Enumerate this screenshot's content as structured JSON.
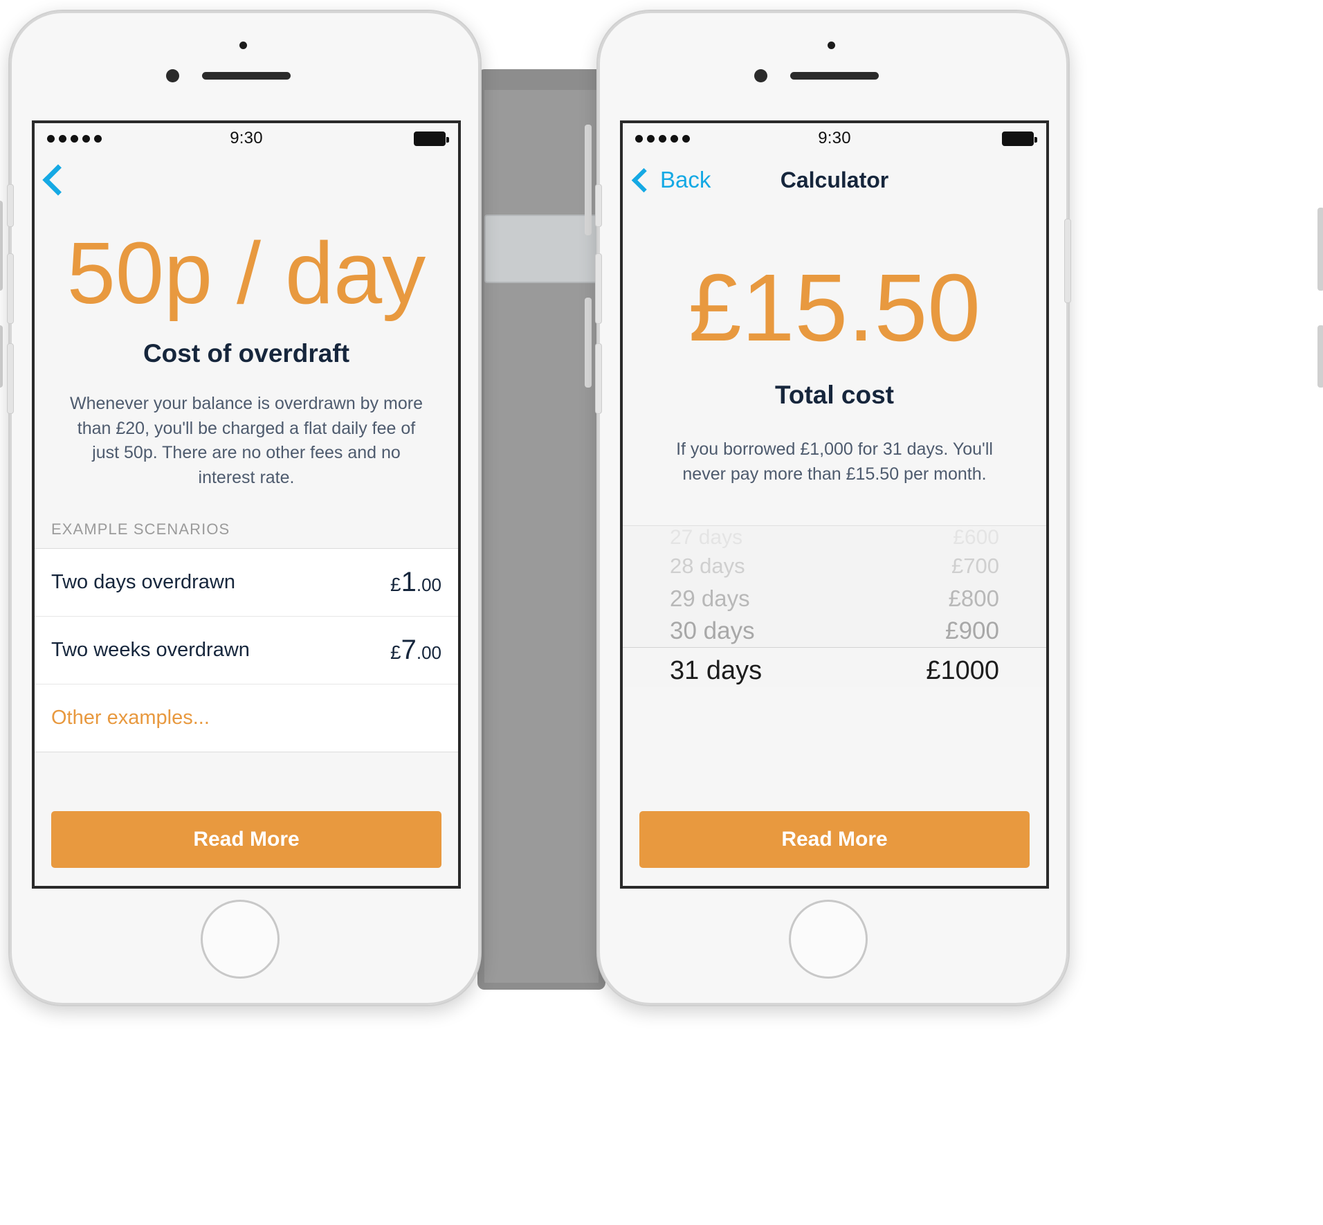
{
  "screens": [
    {
      "id": "cost-of-overdraft",
      "status": {
        "time": "9:30",
        "signal_dots": 5,
        "battery": "full"
      },
      "nav": {
        "back_label": "",
        "title": ""
      },
      "hero": {
        "amount": "50p / day",
        "label": "Cost of overdraft",
        "description": "Whenever your balance is overdrawn by more than £20, you'll be charged a flat daily fee of just 50p. There are no other fees and no interest rate."
      },
      "section_header": "EXAMPLE SCENARIOS",
      "rows": [
        {
          "label": "Two days overdrawn",
          "currency": "£",
          "major": "1",
          "minor": ".00"
        },
        {
          "label": "Two weeks overdrawn",
          "currency": "£",
          "major": "7",
          "minor": ".00"
        }
      ],
      "more_link": "Other examples...",
      "cta": "Read More"
    },
    {
      "id": "calculator",
      "status": {
        "time": "9:30",
        "signal_dots": 5,
        "battery": "full"
      },
      "nav": {
        "back_label": "Back",
        "title": "Calculator"
      },
      "hero": {
        "amount": "£15.50",
        "label": "Total cost",
        "description": "If you borrowed £1,000 for 31 days. You'll never pay more than £15.50 per month."
      },
      "picker": {
        "rows": [
          {
            "days": "27 days",
            "amount": "£600"
          },
          {
            "days": "28 days",
            "amount": "£700"
          },
          {
            "days": "29 days",
            "amount": "£800"
          },
          {
            "days": "30 days",
            "amount": "£900"
          },
          {
            "days": "31 days",
            "amount": "£1000"
          }
        ],
        "selected_index": 4
      },
      "cta": "Read More"
    }
  ],
  "colors": {
    "accent": "#e8993f",
    "navy": "#16263c",
    "link_blue": "#15a9e4",
    "body_text": "#4e5b6e",
    "muted": "#9b9b9b"
  }
}
